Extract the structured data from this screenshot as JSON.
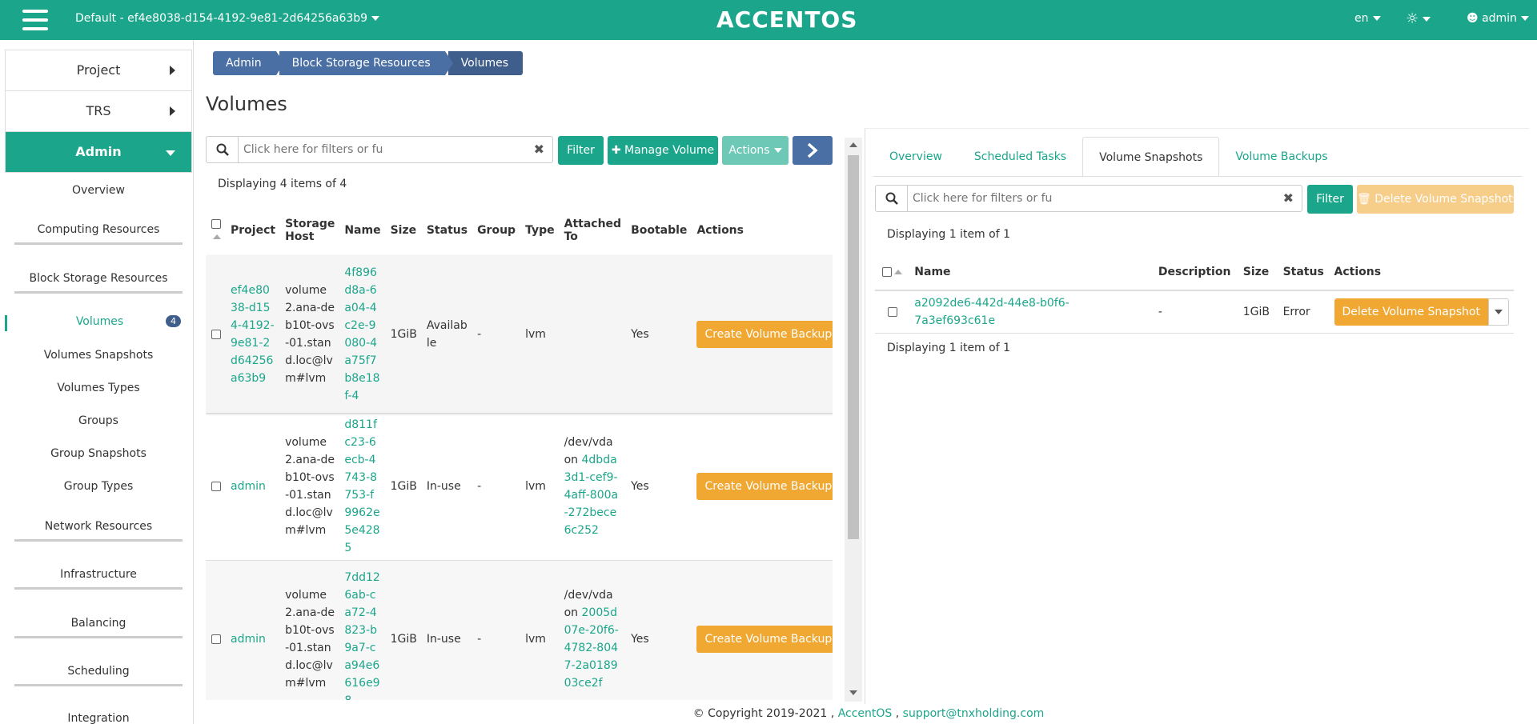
{
  "header": {
    "project": "Default - ef4e8038-d154-4192-9e81-2d64256a63b9",
    "brand": "ACCENTOS",
    "language": "en",
    "user": "admin"
  },
  "sidebar": {
    "project": "Project",
    "trs": "TRS",
    "admin": "Admin",
    "items": {
      "overview": "Overview",
      "computing": "Computing Resources",
      "block_storage": "Block Storage Resources",
      "volumes": "Volumes",
      "volumes_badge": "4",
      "volumes_snapshots": "Volumes Snapshots",
      "volumes_types": "Volumes Types",
      "groups": "Groups",
      "group_snapshots": "Group Snapshots",
      "group_types": "Group Types",
      "network": "Network Resources",
      "infrastructure": "Infrastructure",
      "balancing": "Balancing",
      "scheduling": "Scheduling",
      "integration": "Integration"
    }
  },
  "breadcrumb": [
    "Admin",
    "Block Storage Resources",
    "Volumes"
  ],
  "page_title": "Volumes",
  "left": {
    "search_placeholder": "Click here for filters or full text search.",
    "filter": "Filter",
    "manage_volume": "Manage Volume",
    "actions": "Actions",
    "displaying": "Displaying 4 items of 4",
    "columns": {
      "project": "Project",
      "storage_host": "Storage Host",
      "name": "Name",
      "size": "Size",
      "status": "Status",
      "group": "Group",
      "type": "Type",
      "attached": "Attached To",
      "bootable": "Bootable",
      "actions": "Actions"
    },
    "rows": [
      {
        "project": "ef4e8038-d154-4192-9e81-2d64256a63b9",
        "host": "volume2.ana-deb10t-ovs-01.stand.loc@lvm#lvm",
        "name": "4f896d8a-6a04-4c2e-9080-4a75f7b8e18f-4",
        "size": "1GiB",
        "status": "Available",
        "group": "-",
        "type": "lvm",
        "attached_prefix": "",
        "attached_link": "",
        "bootable": "Yes",
        "action": "Create Volume Backup"
      },
      {
        "project": "admin",
        "host": "volume2.ana-deb10t-ovs-01.stand.loc@lvm#lvm",
        "name": "d811fc23-6ecb-4743-8753-f9962e5e4285",
        "size": "1GiB",
        "status": "In-use",
        "group": "-",
        "type": "lvm",
        "attached_prefix": "/dev/vda on",
        "attached_link": "4dbda3d1-cef9-4aff-800a-272bece6c252",
        "bootable": "Yes",
        "action": "Create Volume Backup"
      },
      {
        "project": "admin",
        "host": "volume2.ana-deb10t-ovs-01.stand.loc@lvm#lvm",
        "name": "7dd126ab-ca72-4823-b9a7-ca94e6616e98",
        "size": "1GiB",
        "status": "In-use",
        "group": "-",
        "type": "lvm",
        "attached_prefix": "/dev/vda on",
        "attached_link": "2005d07e-20f6-4782-8047-2a018903ce2f",
        "bootable": "Yes",
        "action": "Create Volume Backup"
      }
    ]
  },
  "right": {
    "tabs": [
      "Overview",
      "Scheduled Tasks",
      "Volume Snapshots",
      "Volume Backups"
    ],
    "search_placeholder": "Click here for filters or full text search.",
    "filter": "Filter",
    "delete_snapshots": "Delete Volume Snapshots",
    "displaying": "Displaying 1 item of 1",
    "columns": {
      "name": "Name",
      "description": "Description",
      "size": "Size",
      "status": "Status",
      "actions": "Actions"
    },
    "row": {
      "name": "a2092de6-442d-44e8-b0f6-7a3ef693c61e",
      "description": "-",
      "size": "1GiB",
      "status": "Error",
      "action": "Delete Volume Snapshot"
    },
    "displaying_bottom": "Displaying 1 item of 1"
  },
  "footer": {
    "copyright": "© Copyright 2019-2021 ,",
    "accentos": "AccentOS",
    "sep": ",",
    "support": "support@tnxholding.com"
  }
}
